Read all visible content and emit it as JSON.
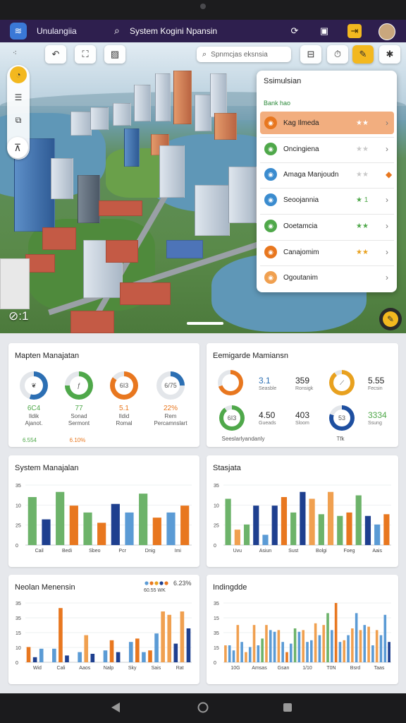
{
  "app": {
    "name": "Unulangiia",
    "title": "System Kogini Npansin"
  },
  "scene": {
    "search_placeholder": "Spnmcjas eksnsia",
    "scale_label": "⊘:1",
    "panel": {
      "title": "Ssimulsian",
      "subtitle": "Bank hao",
      "items": [
        {
          "label": "Kag Ilmeda",
          "stars": "★★",
          "icon_color": "#e8771f",
          "star_color": "#ffffff",
          "active": true
        },
        {
          "label": "Oncingiena",
          "stars": "★★",
          "icon_color": "#4fa84a",
          "star_color": "#c8c8c8",
          "active": false
        },
        {
          "label": "Amaga Manjoudn",
          "stars": "★★",
          "icon_color": "#3b8ccf",
          "star_color": "#c8c8c8",
          "active": false,
          "badge": "◆"
        },
        {
          "label": "Seoojannia",
          "stars": "★ 1",
          "icon_color": "#3b8ccf",
          "star_color": "#4fa84a",
          "active": false
        },
        {
          "label": "Ooetamcia",
          "stars": "★★",
          "icon_color": "#4fa84a",
          "star_color": "#4fa84a",
          "active": false
        },
        {
          "label": "Canajomim",
          "stars": "★★",
          "icon_color": "#e8771f",
          "star_color": "#e8a11f",
          "active": false
        },
        {
          "label": "Ogoutanim",
          "stars": "",
          "icon_color": "#f0a050",
          "star_color": "#c8c8c8",
          "active": false
        }
      ]
    }
  },
  "cards": {
    "card1": {
      "title": "Mapten Manajatan",
      "gauges": [
        {
          "value": "6C4",
          "value_color": "#4fa84a",
          "sub1": "Ildik",
          "sub2": "Ajanot.",
          "level": 0.55,
          "color": "#2c6fb3",
          "icon": "leaf-icon",
          "glyph": "❦"
        },
        {
          "value": "77",
          "value_color": "#4fa84a",
          "sub1": "Sonad",
          "sub2": "Sermont",
          "level": 0.75,
          "color": "#4fa84a",
          "icon": "dollar-icon",
          "glyph": "ƒ"
        },
        {
          "value": "5.1",
          "value_color": "#e8771f",
          "sub1": "Ildid",
          "sub2": "Romal",
          "level": 0.85,
          "color": "#e8771f",
          "icon": "gauge-text",
          "glyph": "6I3"
        },
        {
          "value": "22%",
          "value_color": "#e8771f",
          "sub1": "Rem",
          "sub2": "Percamnslart",
          "level": 0.25,
          "color": "#2c6fb3",
          "icon": "gauge-text",
          "glyph": "6/75"
        }
      ],
      "footer_left": "6.554",
      "footer_right": "6.10%"
    },
    "card2": {
      "title": "Eemigarde Mamiansn",
      "rings": [
        {
          "glyph": "",
          "level": 0.7,
          "color": "#e8771f"
        },
        {
          "glyph": "⟋",
          "level": 0.9,
          "color": "#e8a11f"
        },
        {
          "glyph": "6I3",
          "level": 0.9,
          "color": "#4fa84a"
        },
        {
          "glyph": "53",
          "level": 0.8,
          "color": "#1e4fa0"
        }
      ],
      "stats": [
        {
          "value": "3.1",
          "label": "Seasble",
          "value_color": "#2c6fb3"
        },
        {
          "value": "359",
          "label": "Ronsigk",
          "value_color": "#222"
        },
        {
          "value": "5.55",
          "label": "Fecsin",
          "value_color": "#222"
        },
        {
          "value": "4.50",
          "label": "Gueads",
          "value_color": "#222"
        },
        {
          "value": "403",
          "label": "Sloom",
          "value_color": "#222"
        },
        {
          "value": "3334",
          "label": "Ssung",
          "value_color": "#4fa84a"
        }
      ],
      "footer_left": "Seeslarlyandanly",
      "footer_right": "Tfk"
    }
  },
  "chart_data": [
    {
      "type": "bar",
      "title": "System Manajalan",
      "yticks": [
        "35",
        "10",
        "25",
        "0"
      ],
      "ylim": [
        0,
        35
      ],
      "categories": [
        "Cail",
        "Bedi",
        "Sbeo",
        "Pcr",
        "Dnig",
        "Imi"
      ],
      "values": [
        28,
        15,
        31,
        23,
        19,
        13,
        24,
        19,
        30,
        16,
        19,
        23
      ],
      "colors": [
        "#6db36a",
        "#1e3f8f",
        "#6db36a",
        "#e8771f",
        "#6db36a",
        "#e8771f",
        "#1e3f8f",
        "#5b9bd5",
        "#6db36a",
        "#e8771f",
        "#5b9bd5",
        "#e8771f"
      ]
    },
    {
      "type": "bar",
      "title": "Stasjata",
      "yticks": [
        "35",
        "10",
        "25",
        "0"
      ],
      "ylim": [
        0,
        35
      ],
      "categories": [
        "Uvu",
        "Asiun",
        "Sust",
        "Bolgi",
        "Foeg",
        "Aais"
      ],
      "values": [
        27,
        9,
        12,
        23,
        6,
        23,
        28,
        19,
        31,
        27,
        18,
        31,
        17,
        19,
        29,
        17,
        12,
        18
      ],
      "colors": [
        "#6db36a",
        "#f0a050",
        "#6db36a",
        "#1e3f8f",
        "#5b9bd5",
        "#1e3f8f",
        "#e8771f",
        "#6db36a",
        "#1e3f8f",
        "#f0a050",
        "#6db36a",
        "#f0a050",
        "#6db36a",
        "#e8771f",
        "#6db36a",
        "#1e3f8f",
        "#5b9bd5",
        "#e8771f"
      ]
    },
    {
      "type": "bar",
      "title": "Neolan Menensin",
      "yticks": [
        "35",
        "35",
        "15",
        "10",
        "0"
      ],
      "ylim": [
        0,
        35
      ],
      "legend_text": "6.23%",
      "legend_sub": "60.55 WK",
      "legend_colors": [
        "#5b9bd5",
        "#e8771f",
        "#e8a11f",
        "#1e3f8f",
        "#e8771f"
      ],
      "categories": [
        "Wid",
        "Cali",
        "Aaos",
        "Nalp",
        "Sky",
        "Sais",
        "Rat"
      ],
      "values": [
        9,
        3,
        8,
        0,
        8,
        32,
        4,
        0,
        6,
        16,
        5,
        0,
        7,
        13,
        6,
        0,
        12,
        14,
        6,
        7,
        17,
        30,
        28,
        11,
        30,
        20
      ],
      "colors": [
        "#e8771f",
        "#1e3f8f",
        "#5b9bd5",
        "#ffffff",
        "#5b9bd5",
        "#e8771f",
        "#1e3f8f",
        "#ffffff",
        "#5b9bd5",
        "#f0a050",
        "#1e3f8f",
        "#ffffff",
        "#5b9bd5",
        "#e8771f",
        "#1e3f8f",
        "#ffffff",
        "#5b9bd5",
        "#e8771f",
        "#5b9bd5",
        "#e8771f",
        "#5b9bd5",
        "#f0a050",
        "#f0a050",
        "#1e3f8f",
        "#f0a050",
        "#1e3f8f"
      ]
    },
    {
      "type": "bar",
      "title": "Indingdde",
      "yticks": [
        "35",
        "15",
        "35",
        "15",
        "0"
      ],
      "ylim": [
        0,
        35
      ],
      "categories": [
        "10G",
        "Amsas",
        "Gsan",
        "1/10",
        "T0N",
        "Bsrd",
        "Taas"
      ],
      "values": [
        10,
        10,
        7,
        22,
        12,
        6,
        9,
        22,
        10,
        14,
        22,
        19,
        18,
        19,
        12,
        6,
        11,
        20,
        18,
        19,
        12,
        13,
        23,
        16,
        22,
        29,
        19,
        35,
        12,
        13,
        16,
        20,
        29,
        19,
        22,
        21,
        10,
        19,
        16,
        28,
        12
      ],
      "colors": [
        "#f0a050",
        "#5b9bd5",
        "#5b9bd5",
        "#f0a050",
        "#5b9bd5",
        "#f0a050",
        "#5b9bd5",
        "#f0a050",
        "#5b9bd5",
        "#6db36a",
        "#f0a050",
        "#5b9bd5",
        "#5b9bd5",
        "#f0a050",
        "#5b9bd5",
        "#e8771f",
        "#5b9bd5",
        "#6db36a",
        "#5b9bd5",
        "#f0a050",
        "#5b9bd5",
        "#5b9bd5",
        "#f0a050",
        "#5b9bd5",
        "#f0a050",
        "#6db36a",
        "#5b9bd5",
        "#e8771f",
        "#5b9bd5",
        "#f0a050",
        "#5b9bd5",
        "#f0a050",
        "#5b9bd5",
        "#f0a050",
        "#5b9bd5",
        "#f0a050",
        "#5b9bd5",
        "#f0a050",
        "#5b9bd5",
        "#5b9bd5",
        "#1e3f8f"
      ]
    }
  ],
  "icons": {
    "logo": "app-logo-icon",
    "search": "search-icon",
    "refresh": "refresh-icon",
    "calendar": "calendar-icon",
    "exit": "exit-icon",
    "avatar": "avatar"
  }
}
